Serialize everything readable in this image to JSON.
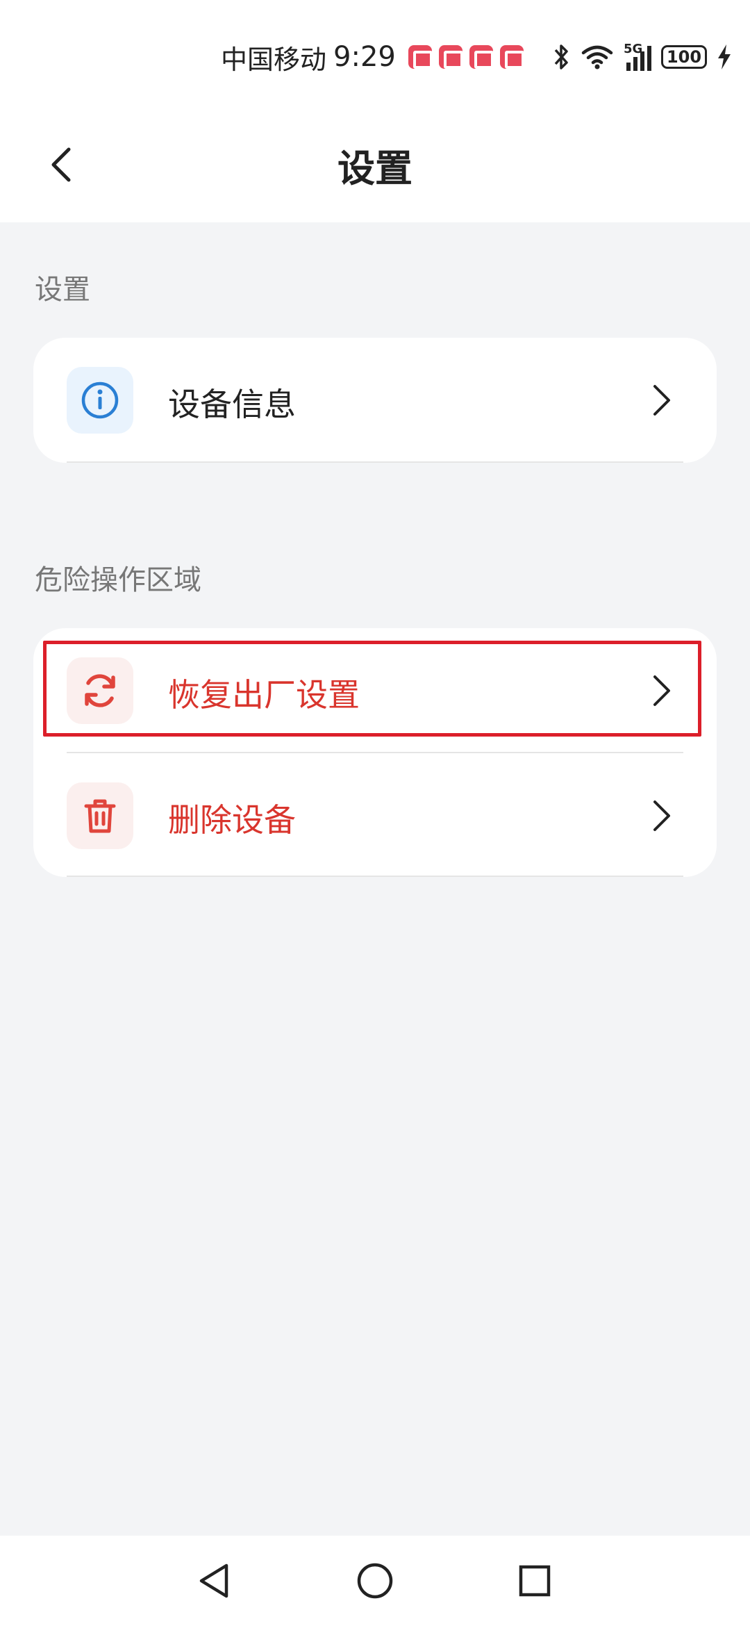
{
  "status_bar": {
    "carrier": "中国移动",
    "time": "9:29",
    "battery": "100",
    "network": "5G"
  },
  "header": {
    "title": "设置",
    "back_icon": "chevron-left-icon"
  },
  "sections": [
    {
      "label": "设置",
      "items": [
        {
          "label": "设备信息",
          "icon": "info-icon",
          "color": "#222222",
          "icon_color": "#2a7fd4",
          "icon_bg": "#e9f3fd"
        }
      ]
    },
    {
      "label": "危险操作区域",
      "items": [
        {
          "label": "恢复出厂设置",
          "icon": "refresh-icon",
          "color": "#d9352d",
          "icon_color": "#e0453c",
          "icon_bg": "#fbefee"
        },
        {
          "label": "删除设备",
          "icon": "trash-icon",
          "color": "#d9352d",
          "icon_color": "#e0453c",
          "icon_bg": "#fbefee"
        }
      ]
    }
  ],
  "nav": {
    "back": "triangle-back-icon",
    "home": "circle-home-icon",
    "recents": "square-recents-icon"
  },
  "colors": {
    "danger": "#d9352d",
    "highlight": "#dc1f2a",
    "background": "#f3f4f6"
  }
}
